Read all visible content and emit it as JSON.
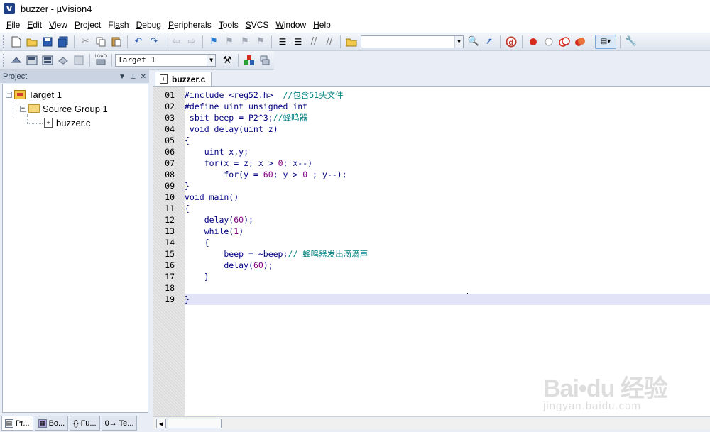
{
  "window": {
    "title": "buzzer  - µVision4",
    "logo": "V"
  },
  "menu": [
    {
      "label": "File",
      "ul": "F",
      "rest": "ile"
    },
    {
      "label": "Edit",
      "ul": "E",
      "rest": "dit"
    },
    {
      "label": "View",
      "ul": "V",
      "rest": "iew"
    },
    {
      "label": "Project",
      "ul": "P",
      "rest": "roject"
    },
    {
      "label": "Flash",
      "pre": "Fl",
      "ul": "a",
      "rest": "sh"
    },
    {
      "label": "Debug",
      "ul": "D",
      "rest": "ebug"
    },
    {
      "label": "Peripherals",
      "ul": "P",
      "rest": "eripherals"
    },
    {
      "label": "Tools",
      "ul": "T",
      "rest": "ools"
    },
    {
      "label": "SVCS",
      "ul": "S",
      "rest": "VCS"
    },
    {
      "label": "Window",
      "ul": "W",
      "rest": "indow"
    },
    {
      "label": "Help",
      "ul": "H",
      "rest": "elp"
    }
  ],
  "toolbar": {
    "target_combo": "Target 1",
    "find_combo": "",
    "load_label": "LOAD"
  },
  "project_panel": {
    "title": "Project",
    "tree": {
      "target": "Target 1",
      "group": "Source Group 1",
      "file": "buzzer.c"
    },
    "bottom_tabs": [
      "Pr...",
      "Bo...",
      "{} Fu...",
      "0→ Te..."
    ]
  },
  "editor": {
    "tab": "buzzer.c",
    "lines": [
      {
        "n": "01",
        "segs": [
          [
            "pre",
            "#include <reg52.h>  "
          ],
          [
            "cm",
            "//包含51头文件"
          ]
        ]
      },
      {
        "n": "02",
        "segs": [
          [
            "pre",
            "#define uint unsigned int"
          ]
        ]
      },
      {
        "n": "03",
        "segs": [
          [
            "txt",
            " sbit beep = P2^3;"
          ],
          [
            "cm",
            "//蜂鸣器"
          ]
        ]
      },
      {
        "n": "04",
        "segs": [
          [
            "txt",
            " void delay(uint z)"
          ]
        ]
      },
      {
        "n": "05",
        "segs": [
          [
            "txt",
            "{"
          ]
        ]
      },
      {
        "n": "06",
        "segs": [
          [
            "txt",
            "    uint x,y;"
          ]
        ]
      },
      {
        "n": "07",
        "segs": [
          [
            "txt",
            "    for(x = z; x > "
          ],
          [
            "num",
            "0"
          ],
          [
            "txt",
            "; x--)"
          ]
        ]
      },
      {
        "n": "08",
        "segs": [
          [
            "txt",
            "        for(y = "
          ],
          [
            "num",
            "60"
          ],
          [
            "txt",
            "; y > "
          ],
          [
            "num",
            "0"
          ],
          [
            "txt",
            " ; y--);"
          ]
        ]
      },
      {
        "n": "09",
        "segs": [
          [
            "txt",
            "}"
          ]
        ]
      },
      {
        "n": "10",
        "segs": [
          [
            "txt",
            "void main()"
          ]
        ]
      },
      {
        "n": "11",
        "segs": [
          [
            "txt",
            "{"
          ]
        ]
      },
      {
        "n": "12",
        "segs": [
          [
            "txt",
            "    delay("
          ],
          [
            "num",
            "60"
          ],
          [
            "txt",
            ");"
          ]
        ]
      },
      {
        "n": "13",
        "segs": [
          [
            "txt",
            "    while("
          ],
          [
            "num",
            "1"
          ],
          [
            "txt",
            ")"
          ]
        ]
      },
      {
        "n": "14",
        "segs": [
          [
            "txt",
            "    {"
          ]
        ]
      },
      {
        "n": "15",
        "segs": [
          [
            "txt",
            "        beep = ~beep;"
          ],
          [
            "cm",
            "// 蜂鸣器发出滴滴声"
          ]
        ]
      },
      {
        "n": "16",
        "segs": [
          [
            "txt",
            "        delay("
          ],
          [
            "num",
            "60"
          ],
          [
            "txt",
            ");"
          ]
        ]
      },
      {
        "n": "17",
        "segs": [
          [
            "txt",
            "    }"
          ]
        ]
      },
      {
        "n": "18",
        "segs": [
          [
            "txt",
            ""
          ]
        ]
      },
      {
        "n": "19",
        "segs": [
          [
            "txt",
            "}"
          ]
        ]
      }
    ],
    "highlighted_line": "19"
  },
  "watermark": {
    "main": "Bai•du 经验",
    "sub": "jingyan.baidu.com"
  },
  "colors": {
    "preprocessor": "#000080",
    "comment": "#008080",
    "number": "#800080",
    "highlight": "#e3e3f8"
  }
}
